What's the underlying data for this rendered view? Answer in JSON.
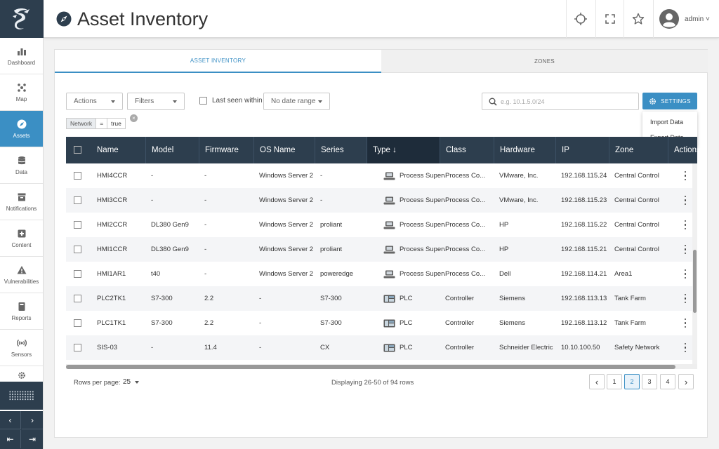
{
  "header": {
    "title": "Asset Inventory",
    "user": "admin"
  },
  "sidebar": {
    "items": [
      {
        "label": "Dashboard",
        "icon": "dashboard-icon"
      },
      {
        "label": "Map",
        "icon": "map-icon"
      },
      {
        "label": "Assets",
        "icon": "compass-icon",
        "active": true
      },
      {
        "label": "Data",
        "icon": "database-icon"
      },
      {
        "label": "Notifications",
        "icon": "inbox-icon"
      },
      {
        "label": "Content",
        "icon": "content-icon"
      },
      {
        "label": "Vulnerabilities",
        "icon": "warning-icon"
      },
      {
        "label": "Reports",
        "icon": "book-icon"
      },
      {
        "label": "Sensors",
        "icon": "sensor-icon"
      }
    ]
  },
  "tabs": [
    {
      "label": "ASSET INVENTORY",
      "active": true
    },
    {
      "label": "ZONES",
      "active": false
    }
  ],
  "toolbar": {
    "actions": "Actions",
    "filters": "Filters",
    "last_seen": "Last seen within",
    "date_range": "No date range",
    "search_placeholder": "e.g. 10.1.5.0/24",
    "settings": "SETTINGS"
  },
  "settings_menu": [
    "Import Data",
    "Export Data"
  ],
  "filter_chip": {
    "field": "Network",
    "op": "=",
    "value": "true"
  },
  "table": {
    "columns": [
      "Name",
      "Model",
      "Firmware",
      "OS Name",
      "Series",
      "Type ↓",
      "Class",
      "Hardware",
      "IP",
      "Zone",
      "Actions"
    ],
    "rows": [
      {
        "name": "HMI4CCR",
        "model": "-",
        "firmware": "-",
        "os": "Windows Server 2",
        "series": "-",
        "type": "Process Superv",
        "type_icon": "workstation-icon",
        "class": "Process Co...",
        "hardware": "VMware, Inc.",
        "ip": "192.168.115.24",
        "zone": "Central Control"
      },
      {
        "name": "HMI3CCR",
        "model": "-",
        "firmware": "-",
        "os": "Windows Server 2",
        "series": "-",
        "type": "Process Superv",
        "type_icon": "workstation-icon",
        "class": "Process Co...",
        "hardware": "VMware, Inc.",
        "ip": "192.168.115.23",
        "zone": "Central Control"
      },
      {
        "name": "HMI2CCR",
        "model": "DL380 Gen9",
        "firmware": "-",
        "os": "Windows Server 2",
        "series": "proliant",
        "type": "Process Superv",
        "type_icon": "workstation-icon",
        "class": "Process Co...",
        "hardware": "HP",
        "ip": "192.168.115.22",
        "zone": "Central Control"
      },
      {
        "name": "HMI1CCR",
        "model": "DL380 Gen9",
        "firmware": "-",
        "os": "Windows Server 2",
        "series": "proliant",
        "type": "Process Superv",
        "type_icon": "workstation-icon",
        "class": "Process Co...",
        "hardware": "HP",
        "ip": "192.168.115.21",
        "zone": "Central Control"
      },
      {
        "name": "HMI1AR1",
        "model": "t40",
        "firmware": "-",
        "os": "Windows Server 2",
        "series": "poweredge",
        "type": "Process Superv",
        "type_icon": "workstation-icon",
        "class": "Process Co...",
        "hardware": "Dell",
        "ip": "192.168.114.21",
        "zone": "Area1"
      },
      {
        "name": "PLC2TK1",
        "model": "S7-300",
        "firmware": "2.2",
        "os": "-",
        "series": "S7-300",
        "type": "PLC",
        "type_icon": "plc-icon",
        "class": "Controller",
        "hardware": "Siemens",
        "ip": "192.168.113.13",
        "zone": "Tank Farm"
      },
      {
        "name": "PLC1TK1",
        "model": "S7-300",
        "firmware": "2.2",
        "os": "-",
        "series": "S7-300",
        "type": "PLC",
        "type_icon": "plc-icon",
        "class": "Controller",
        "hardware": "Siemens",
        "ip": "192.168.113.12",
        "zone": "Tank Farm"
      },
      {
        "name": "SIS-03",
        "model": "-",
        "firmware": "11.4",
        "os": "-",
        "series": "CX",
        "type": "PLC",
        "type_icon": "plc-icon",
        "class": "Controller",
        "hardware": "Schneider Electric",
        "ip": "10.10.100.50",
        "zone": "Safety Network"
      }
    ]
  },
  "footer": {
    "rows_per_page_label": "Rows per page:",
    "rows_per_page": "25",
    "displaying": "Displaying 26-50 of 94 rows",
    "pages": [
      "1",
      "2",
      "3",
      "4"
    ],
    "current_page": "2"
  },
  "scroll": {
    "vertical_position": 0.62,
    "vertical_visible_fraction": 0.31
  },
  "colors": {
    "accent": "#3b8fc4",
    "header_dark": "#2d3e4e"
  }
}
